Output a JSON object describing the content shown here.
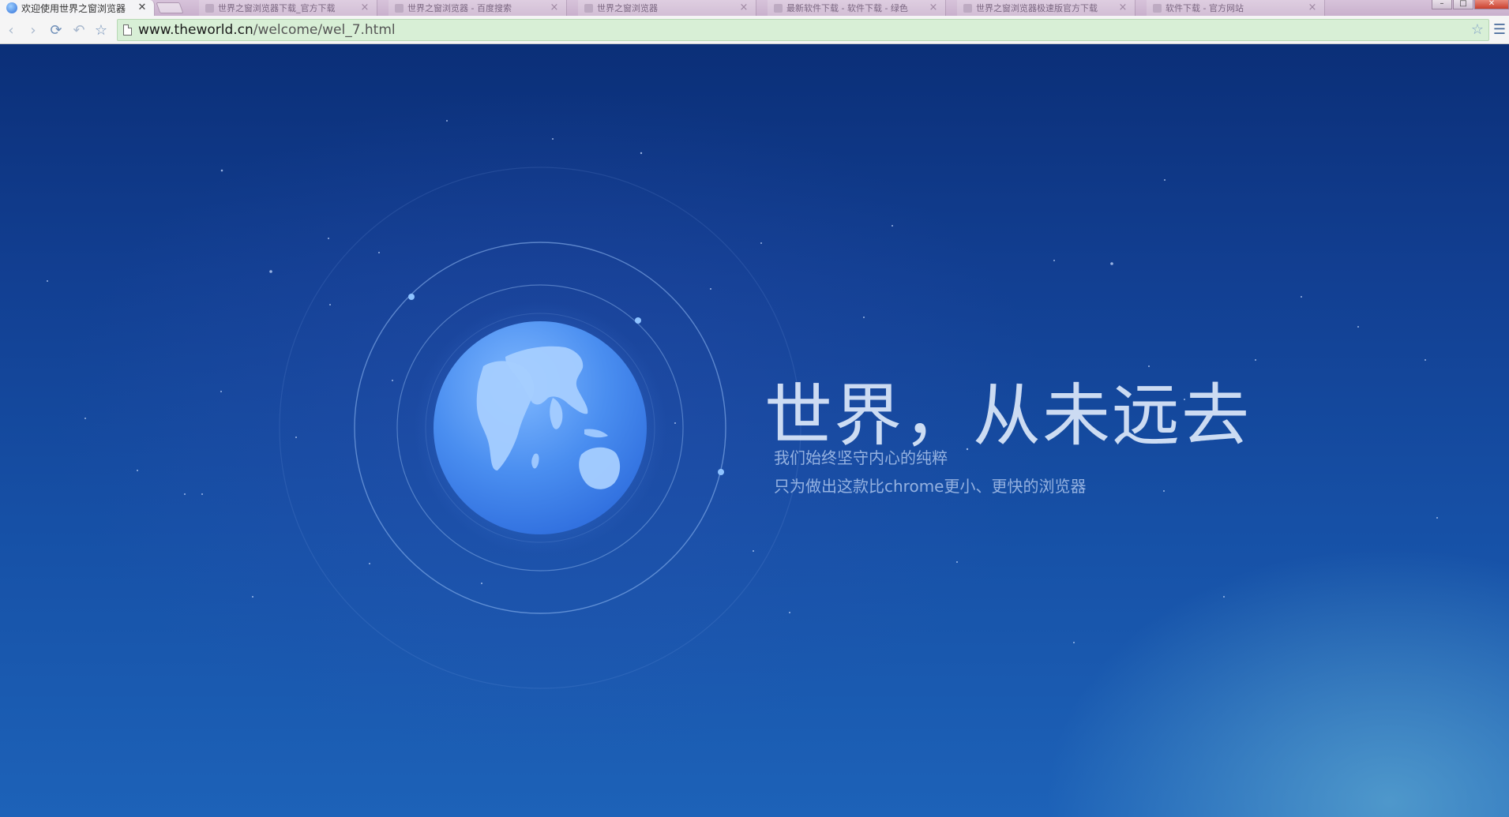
{
  "window": {
    "active_tab": {
      "title": "欢迎使用世界之窗浏览器",
      "close_glyph": "✕"
    },
    "inactive_tabs": [
      {
        "title": "世界之窗浏览器下载_官方下载"
      },
      {
        "title": "世界之窗浏览器 - 百度搜索"
      },
      {
        "title": "世界之窗浏览器"
      },
      {
        "title": "最新软件下载 - 软件下载 - 绿色"
      },
      {
        "title": "世界之窗浏览器极速版官方下载"
      },
      {
        "title": "软件下载 - 官方网站"
      }
    ],
    "controls": {
      "minimize": "–",
      "maximize": "□",
      "close": "✕"
    }
  },
  "toolbar": {
    "back_icon": "‹",
    "forward_icon": "›",
    "reload_icon": "⟳",
    "undo_icon": "↶",
    "favorite_icon": "☆",
    "address": {
      "host": "www.theworld.cn",
      "path": "/welcome/wel_7.html"
    },
    "bookmark_star": "☆",
    "menu_icon": "☰"
  },
  "hero": {
    "headline": "世界，从未远去",
    "subline1": "我们始终坚守内心的纯粹",
    "subline2": "只为做出这款比chrome更小、更快的浏览器"
  },
  "colors": {
    "accent": "#3d82e6",
    "address_bar": "#d8efd6",
    "background_top": "#0b2f78",
    "background_bottom": "#1d62b8"
  }
}
